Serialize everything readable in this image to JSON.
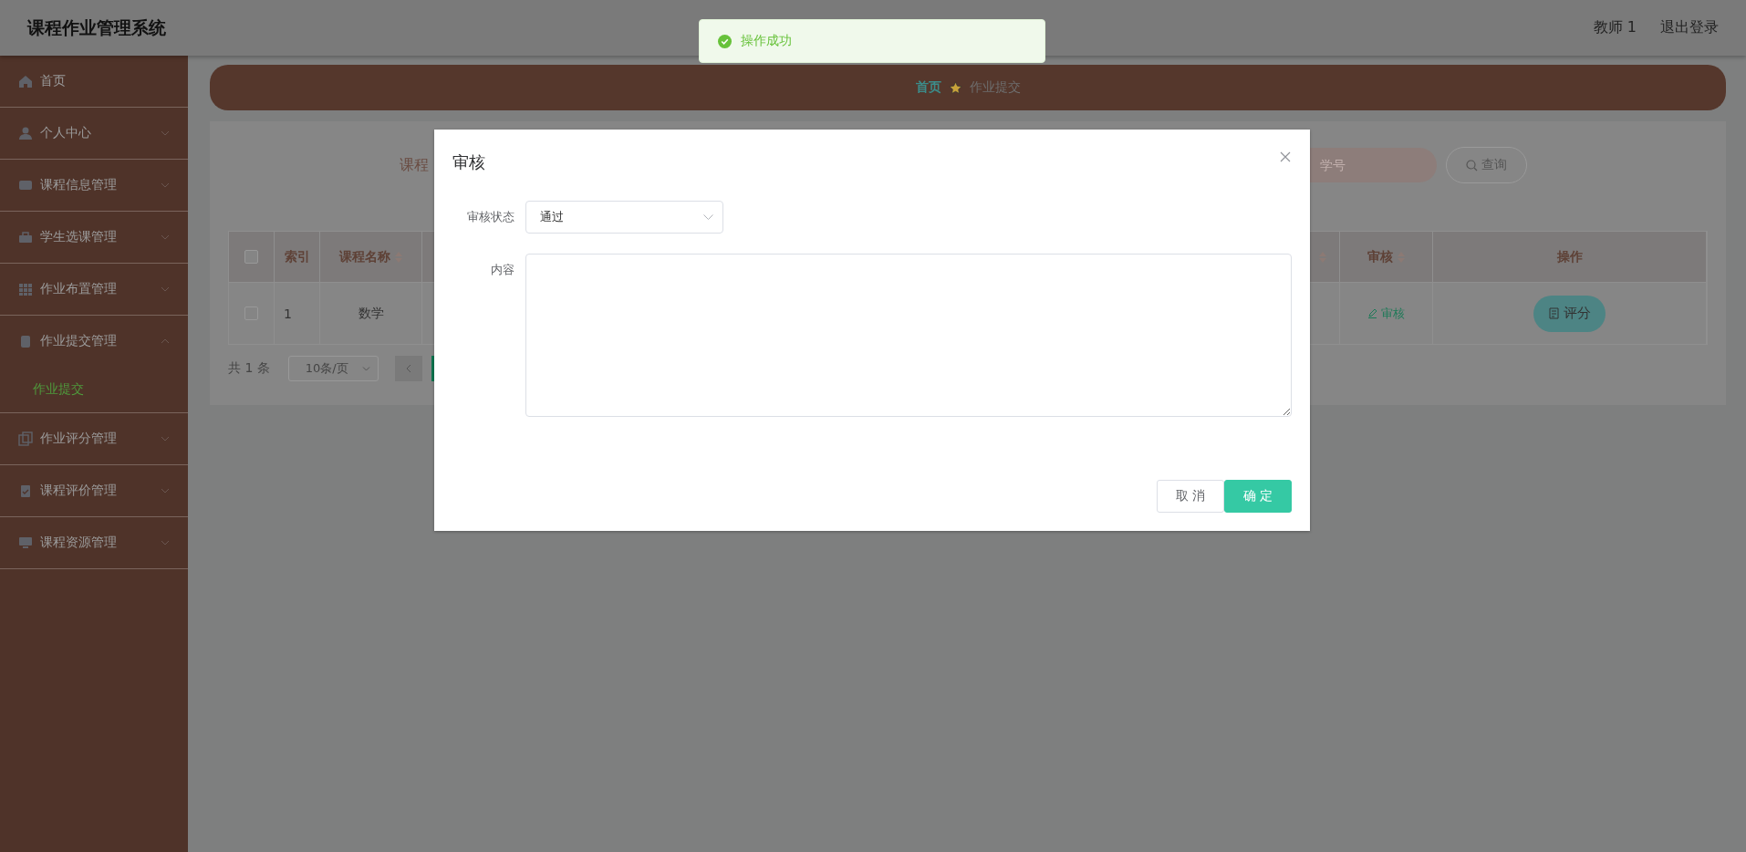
{
  "header": {
    "title": "课程作业管理系统",
    "user": "教师 1",
    "logout": "退出登录"
  },
  "toast": {
    "kind": "success",
    "message": "操作成功"
  },
  "sidebar": {
    "items": [
      {
        "label": "首页",
        "kind": "link"
      },
      {
        "label": "个人中心",
        "kind": "menu",
        "expanded": false
      },
      {
        "label": "课程信息管理",
        "kind": "menu",
        "expanded": false
      },
      {
        "label": "学生选课管理",
        "kind": "menu",
        "expanded": false
      },
      {
        "label": "作业布置管理",
        "kind": "menu",
        "expanded": false
      },
      {
        "label": "作业提交管理",
        "kind": "menu",
        "expanded": true,
        "children": [
          {
            "label": "作业提交",
            "selected": true
          }
        ]
      },
      {
        "label": "作业评分管理",
        "kind": "menu",
        "expanded": false
      },
      {
        "label": "课程评价管理",
        "kind": "menu",
        "expanded": false
      },
      {
        "label": "课程资源管理",
        "kind": "menu",
        "expanded": false
      }
    ]
  },
  "breadcrumb": [
    {
      "label": "首页",
      "kind": "link"
    },
    {
      "label": "作业提交",
      "kind": "current"
    }
  ],
  "search": {
    "label": "课程",
    "placeholder": "学号",
    "button": "查询"
  },
  "table": {
    "columns": [
      {
        "kind": "checkbox",
        "checked": false
      },
      {
        "kind": "text",
        "label": "索引",
        "sortable": false
      },
      {
        "kind": "text",
        "label": "课程名称",
        "sortable": true
      },
      {
        "kind": "covered",
        "sortable": true
      },
      {
        "kind": "text",
        "label": "审核",
        "sortable": true
      },
      {
        "kind": "text",
        "label": "操作",
        "sortable": false
      }
    ],
    "rows": [
      {
        "checked": false,
        "index": "1",
        "course": "数学",
        "review": "审核",
        "action": "评分"
      }
    ]
  },
  "pagination": {
    "total": "共 1 条",
    "page_size": "10条/页",
    "pages": [
      {
        "selected": true
      }
    ]
  },
  "dialog": {
    "title": "审核",
    "fields": [
      {
        "kind": "select",
        "label": "审核状态",
        "value": "通过"
      },
      {
        "kind": "textarea",
        "label": "内容"
      }
    ],
    "buttons": [
      {
        "kind": "default",
        "label": "取 消"
      },
      {
        "kind": "primary",
        "label": "确 定"
      }
    ]
  }
}
